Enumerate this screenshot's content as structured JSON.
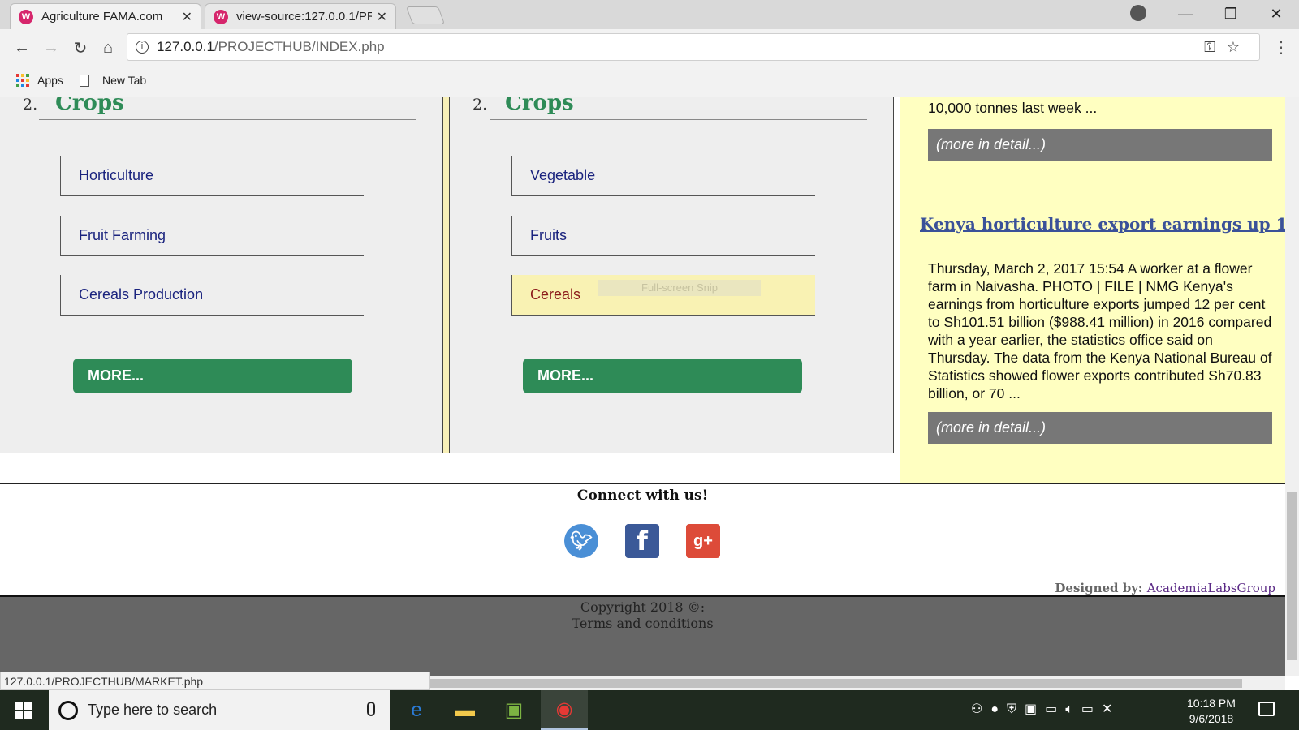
{
  "browser": {
    "tabs": [
      {
        "title": "Agriculture FAMA.com",
        "favicon": "W"
      },
      {
        "title": "view-source:127.0.0.1/PR",
        "favicon": "W"
      }
    ],
    "url_host": "127.0.0.1",
    "url_path": "/PROJECTHUB/INDEX.php",
    "bookmarks": [
      {
        "label": "Apps"
      },
      {
        "label": "New Tab"
      }
    ],
    "status_url": "127.0.0.1/PROJECTHUB/MARKET.php"
  },
  "page": {
    "columns": [
      {
        "number": "2.",
        "title": "Crops",
        "links": [
          "Horticulture",
          "Fruit Farming",
          "Cereals Production"
        ],
        "more_label": "MORE..."
      },
      {
        "number": "2.",
        "title": "Crops",
        "links": [
          "Vegetable",
          "Fruits",
          "Cereals"
        ],
        "more_label": "MORE...",
        "tooltip": "Full-screen Snip"
      }
    ],
    "news": {
      "top_snippet": "10,000 tonnes last week ...",
      "detail_label": "(more in detail...)",
      "headline": "Kenya horticulture export earnings up 1",
      "body": "Thursday, March 2, 2017 15:54 A worker at a flower farm in Naivasha. PHOTO | FILE | NMG Kenya's earnings from horticulture exports jumped 12 per cent to Sh101.51 billion ($988.41 million) in 2016 compared with a year earlier, the statistics office said on Thursday. The data from the Kenya National Bureau of Statistics showed flower exports contributed Sh70.83 billion, or 70 ..."
    },
    "footer": {
      "connect": "Connect with us!",
      "designed_prefix": "Designed by:",
      "designed_by": "AcademiaLabsGroup",
      "copyright": "Copyright 2018 ©:",
      "terms": "Terms and conditions"
    }
  },
  "taskbar": {
    "search_placeholder": "Type here to search",
    "time": "10:18 PM",
    "date": "9/6/2018"
  },
  "colors": {
    "accent_green": "#2e8b57",
    "news_bg": "#ffffc1",
    "link_blue": "#1a237e"
  }
}
